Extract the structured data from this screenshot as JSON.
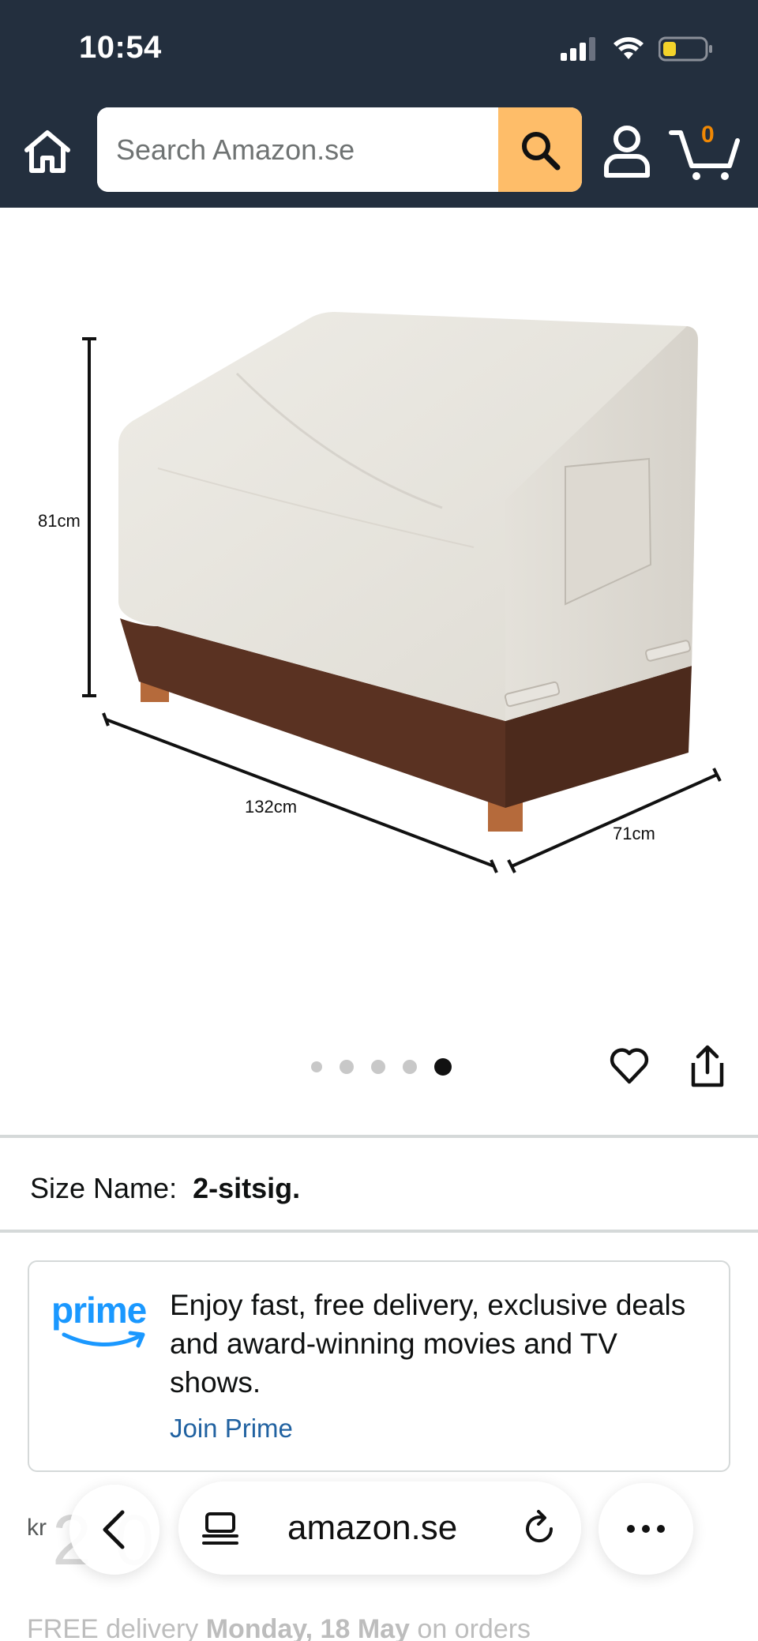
{
  "status_bar": {
    "time": "10:54",
    "signal_icon": "signal-icon",
    "wifi_icon": "wifi-icon",
    "battery_icon": "battery-icon"
  },
  "header": {
    "search_placeholder": "Search Amazon.se",
    "cart_count": "0",
    "colors": {
      "background": "#232f3e",
      "search_button": "#febd69"
    }
  },
  "product_image": {
    "dimension_height": "81cm",
    "dimension_length": "132cm",
    "dimension_depth": "71cm",
    "carousel_total": 5,
    "carousel_active_index": 5
  },
  "size": {
    "label": "Size Name:",
    "value": "2-sitsig."
  },
  "prime": {
    "logo_text": "prime",
    "description": "Enjoy fast, free delivery, exclusive deals and award-winning movies and TV shows.",
    "join_label": "Join Prime",
    "colors": {
      "logo": "#1a98ff",
      "link": "#2162a1"
    }
  },
  "price": {
    "currency": "kr",
    "amount_partial": "2 0"
  },
  "delivery": {
    "prefix": "FREE delivery",
    "date": "Monday, 18 May",
    "suffix": "on orders"
  },
  "browser_bar": {
    "url": "amazon.se"
  }
}
